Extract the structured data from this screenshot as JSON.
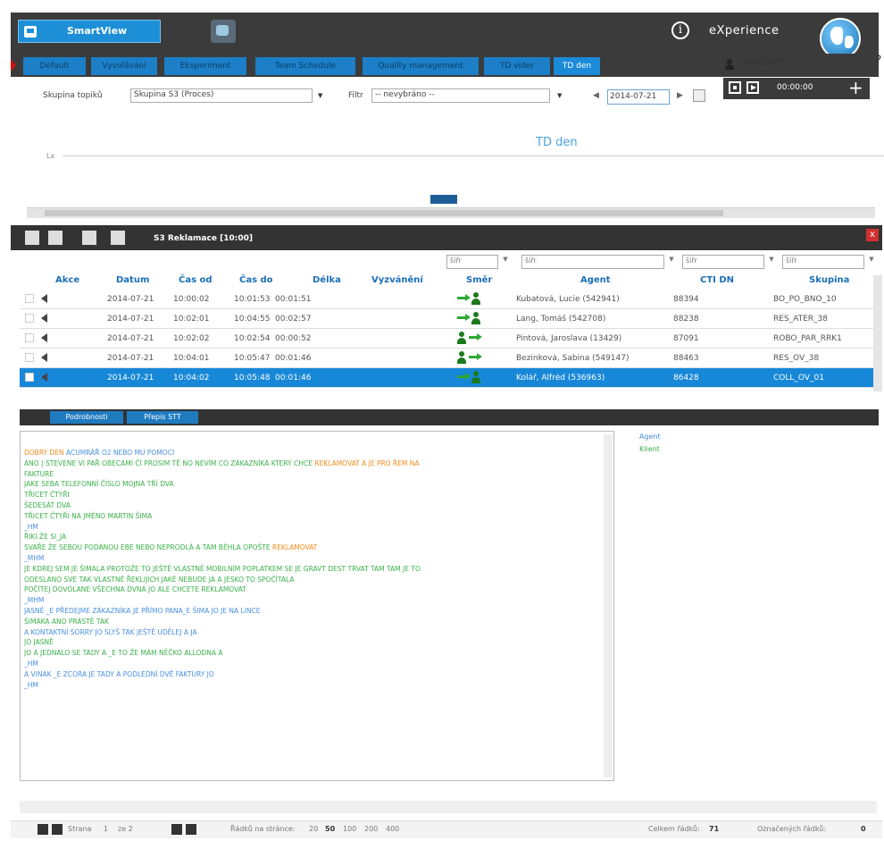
{
  "header": {
    "app_name": "SmartView",
    "brand": "eXperience",
    "user": "Leoš Šeidl",
    "help": "?"
  },
  "tabs": [
    "Default",
    "Vyvolávání",
    "Eksperiment",
    "Team Schedule",
    "Quality management",
    "TD vider",
    "TD den"
  ],
  "active_tab": "TD den",
  "filters": {
    "topic_label": "Skupina topiků",
    "topic_value": "Skupina S3 (Proces)",
    "filter_label": "Filtr",
    "filter_value": "-- nevybráno --",
    "date_value": "2014-07-21",
    "time_value": "00:00:00"
  },
  "chart": {
    "title": "TD den",
    "axis_label": "Lx"
  },
  "grid": {
    "title": "S3 Reklamace [10:00]",
    "filter_placeholder": "šířr",
    "columns": [
      "Akce",
      "Datum",
      "Čas od",
      "Čas do",
      "Délka",
      "Vyzvánění",
      "Směr",
      "Agent",
      "CTI DN",
      "Skupina"
    ],
    "rows": [
      {
        "datum": "2014-07-21",
        "od": "10:00:02",
        "do": "10:01:53",
        "delka": "00:01:51",
        "smer": "in",
        "agent": "Kubatová, Lucie (542941)",
        "cti": "88394",
        "skupina": "BO_PO_BNO_10"
      },
      {
        "datum": "2014-07-21",
        "od": "10:02:01",
        "do": "10:04:55",
        "delka": "00:02:57",
        "smer": "in",
        "agent": "Lang, Tomáš (542708)",
        "cti": "88238",
        "skupina": "RES_ATER_38"
      },
      {
        "datum": "2014-07-21",
        "od": "10:02:02",
        "do": "10:02:54",
        "delka": "00:00:52",
        "smer": "out",
        "agent": "Pintová, Jaroslava (13429)",
        "cti": "87091",
        "skupina": "ROBO_PAR_RRK1"
      },
      {
        "datum": "2014-07-21",
        "od": "10:04:01",
        "do": "10:05:47",
        "delka": "00:01:46",
        "smer": "out",
        "agent": "Bezinková, Sabina (549147)",
        "cti": "88463",
        "skupina": "RES_OV_38"
      },
      {
        "datum": "2014-07-21",
        "od": "10:04:02",
        "do": "10:05:48",
        "delka": "00:01:46",
        "smer": "in",
        "agent": "Kolář, Alfréd (536963)",
        "cti": "86428",
        "skupina": "COLL_OV_01"
      }
    ],
    "selected_row": 4
  },
  "detail": {
    "tabs": [
      "Podrobnosti",
      "Přepis STT"
    ],
    "legend_agent": "Agent",
    "legend_client": "Klient",
    "transcript": [
      {
        "speaker": "agent",
        "text": "DOBRÝ DEN ",
        "hi": "",
        "rest": "ACUMRÁŘ O2 NEBO MU POMOCI"
      },
      {
        "speaker": "client",
        "text": "ANO | STEVENE VI PAŘ OBECAMI ČÍ PROSIM TĚ NO NEVÍM CO ZÁKAZNÍKA KTERÝ CHCE ",
        "hi": "REKLAMOVAT A JE PRO ŘEM NA",
        "rest": ""
      },
      {
        "speaker": "client",
        "text": "FAKTURE",
        "hi": "",
        "rest": ""
      },
      {
        "speaker": "client",
        "text": "JAKE SEBA TELEFONNÍ ČÍSLO MOJNA TŘÍ DVA",
        "hi": "",
        "rest": ""
      },
      {
        "speaker": "client",
        "text": "TŘICET ČTYŘI",
        "hi": "",
        "rest": ""
      },
      {
        "speaker": "client",
        "text": "ŠEDESÁT DVA",
        "hi": "",
        "rest": ""
      },
      {
        "speaker": "client",
        "text": "TŘICET ČTYŘI NA JMÉNO MARTIN ŠIMA",
        "hi": "",
        "rest": ""
      },
      {
        "speaker": "agent",
        "text": "_HM",
        "hi": "",
        "rest": ""
      },
      {
        "speaker": "client",
        "text": "ŘIKI ŽE SI_JA",
        "hi": "",
        "rest": ""
      },
      {
        "speaker": "client",
        "text": "SVAŘE ŽE SEBOU PODÁNOU EBE NEBO NEPRODLÁ A TAM BĚHLA OPOŠTE ",
        "hi": "REKLAMOVAT",
        "rest": ""
      },
      {
        "speaker": "agent",
        "text": "_MHM",
        "hi": "",
        "rest": ""
      },
      {
        "speaker": "client",
        "text": "JE KDREJ SEM JE ŠIMALA PROTOŽE TO JEŠTĚ VLASTNĚ MOBILNÍM POPLATKEM SE JE GRAVT DEST TRVAT TAM TAM JE TO",
        "hi": "",
        "rest": ""
      },
      {
        "speaker": "client",
        "text": "ODESLANO SVE TAK VLASTNĚ ŘEKLIJICH JAKÉ NEBUDE JÁ A JESKO TO SPOČÍTALA",
        "hi": "",
        "rest": ""
      },
      {
        "speaker": "client",
        "text": "POČÍTEJ DOVOLANE VŠECHNA DVNA JO ALE CHCETE REKLAMOVAT",
        "hi": "",
        "rest": ""
      },
      {
        "speaker": "agent",
        "text": "_MHM",
        "hi": "",
        "rest": ""
      },
      {
        "speaker": "agent",
        "text": "JASNĚ _E PŘEDEJME ZÁKAZNÍKA JE PŘÍMO PANA_E ŠIMA JO JE NA LINCE",
        "hi": "",
        "rest": ""
      },
      {
        "speaker": "client",
        "text": "ŠIMÁKA ANO PRÁSTĚ TAK",
        "hi": "",
        "rest": ""
      },
      {
        "speaker": "agent",
        "text": "A KONTAKTNÍ SORRY JO SLYŠ TAK JEŠTĚ UDĚLEJ A JA",
        "hi": "",
        "rest": ""
      },
      {
        "speaker": "client",
        "text": "JO JASNĚ",
        "hi": "",
        "rest": ""
      },
      {
        "speaker": "client",
        "text": "JO A JEDNALO SE TADY A _E TO ŽE MÁM NĚČKO ALLODNA A",
        "hi": "",
        "rest": ""
      },
      {
        "speaker": "agent",
        "text": "_HM",
        "hi": "",
        "rest": ""
      },
      {
        "speaker": "agent",
        "text": "A VINAK _E ZCORA JE TADY A PODLEDNÍ DVĚ FAKTURY JO",
        "hi": "",
        "rest": ""
      },
      {
        "speaker": "agent",
        "text": "_HM",
        "hi": "",
        "rest": ""
      }
    ]
  },
  "pager": {
    "page_label": "Strana",
    "page": "1",
    "of": "ze 2",
    "rows_per_page_label": "Řádků na stránce:",
    "options": [
      "20",
      "50",
      "100",
      "200",
      "400"
    ],
    "selected": "50",
    "total_label": "Celkem řádků:",
    "total": "71",
    "marked_label": "Označených řádků:",
    "marked": "0"
  }
}
